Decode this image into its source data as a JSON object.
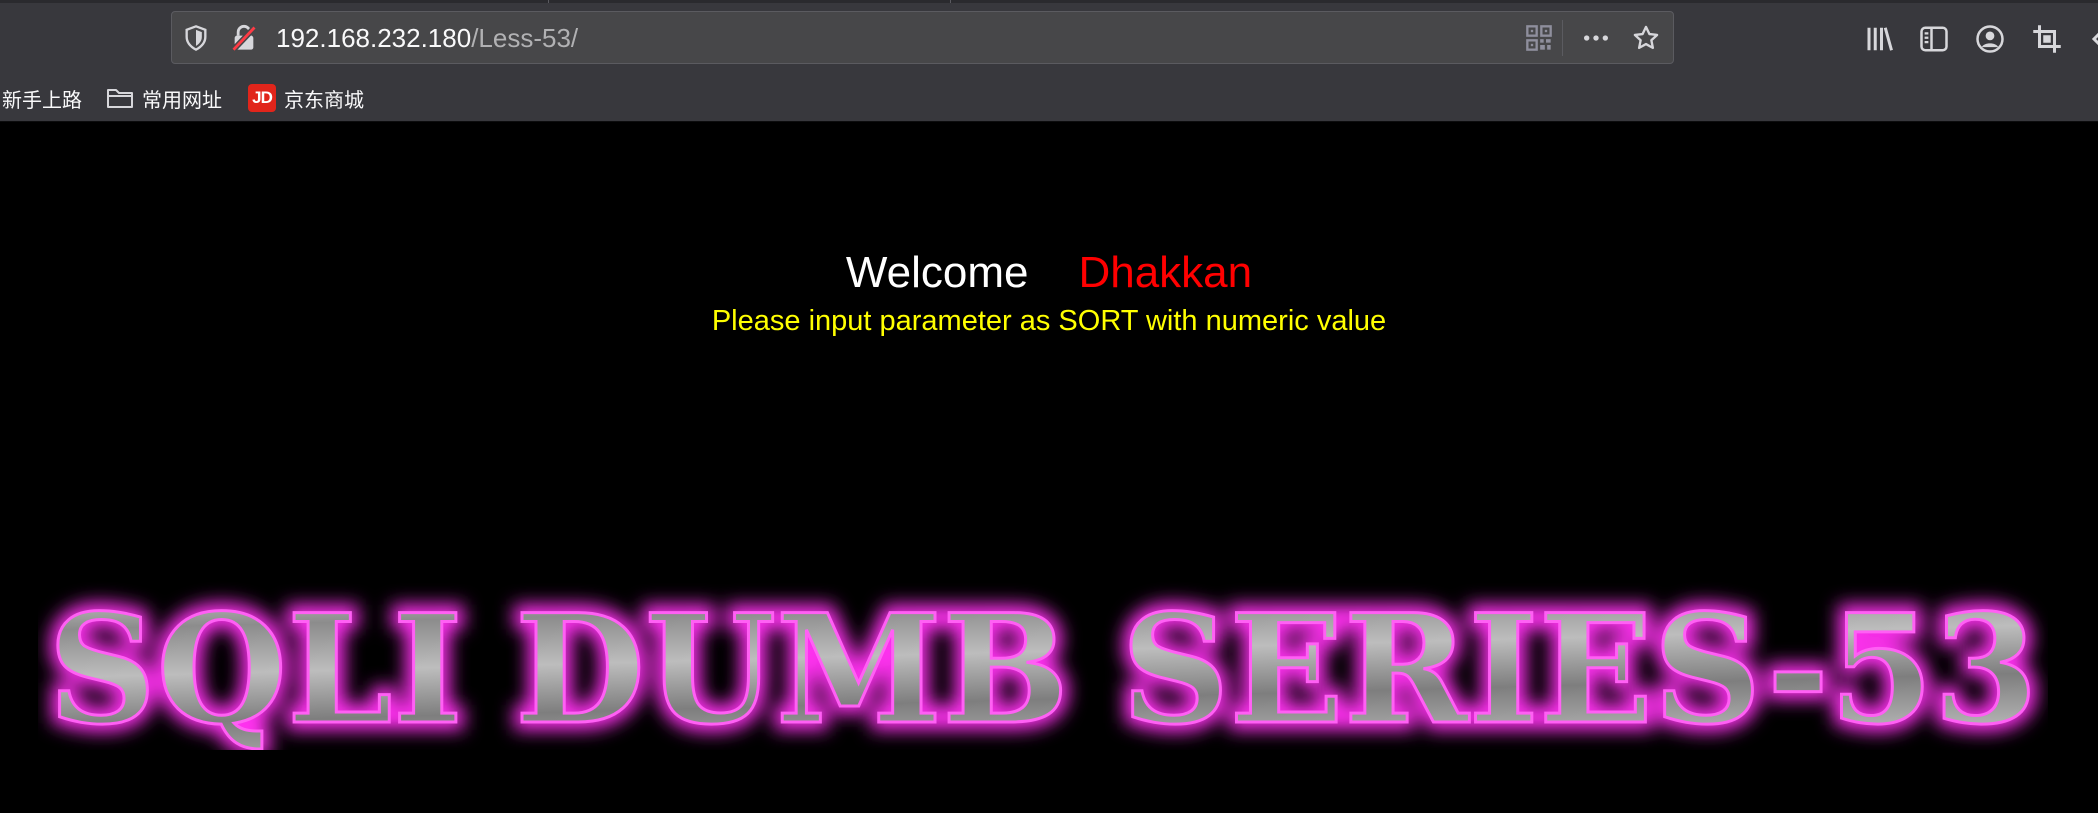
{
  "browser": {
    "url_host": "192.168.232.180",
    "url_path": "/Less-53/",
    "icons": {
      "tracking_protection": "shield-icon",
      "connection": "insecure-lock-icon",
      "qr_code": "qr-code-icon",
      "page_actions": "more-icon",
      "bookmark": "star-icon",
      "library": "library-icon",
      "sidebar": "sidebar-icon",
      "account": "account-icon",
      "screenshot": "crop-icon"
    },
    "bookmarks": [
      {
        "label": "新手上路",
        "icon": "none"
      },
      {
        "label": "常用网址",
        "icon": "folder-icon"
      },
      {
        "label": "京东商城",
        "icon": "jd-logo",
        "logo_text": "JD"
      }
    ]
  },
  "page": {
    "welcome_word": "Welcome",
    "welcome_name": "Dhakkan",
    "instruction": "Please input parameter as SORT with numeric value",
    "title_banner": "SQLI DUMB SERIES-53",
    "colors": {
      "background": "#000000",
      "welcome": "#ffffff",
      "name": "#ff0000",
      "instruction": "#ffff00",
      "banner_glow": "#e020d8",
      "banner_metal": "#a8a8a8"
    }
  }
}
